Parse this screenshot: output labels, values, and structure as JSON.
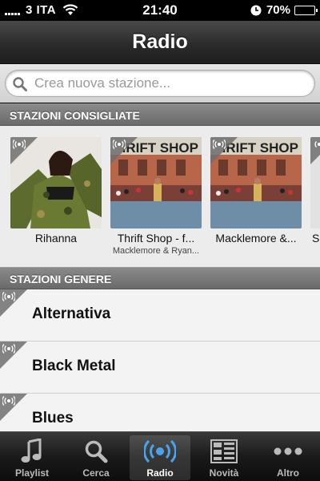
{
  "status_bar": {
    "carrier": "3 ITA",
    "time": "21:40",
    "battery": "70%",
    "battery_level": 0.7
  },
  "nav": {
    "title": "Radio"
  },
  "search": {
    "placeholder": "Crea nuova stazione..."
  },
  "sections": {
    "recommended": "STAZIONI CONSIGLIATE",
    "genres": "STAZIONI GENERE"
  },
  "recommended": [
    {
      "title": "Rihanna",
      "subtitle": ""
    },
    {
      "title": "Thrift Shop - f...",
      "subtitle": "Macklemore & Ryan...",
      "art_text": "IRIFT SHOP"
    },
    {
      "title": "Macklemore &...",
      "subtitle": "",
      "art_text": "IRIFT SHOP"
    },
    {
      "title": "Sc",
      "subtitle": ""
    }
  ],
  "genres": [
    {
      "label": "Alternativa"
    },
    {
      "label": "Black Metal"
    },
    {
      "label": "Blues"
    }
  ],
  "tabs": [
    {
      "label": "Playlist",
      "icon": "music-note-icon"
    },
    {
      "label": "Cerca",
      "icon": "search-icon"
    },
    {
      "label": "Radio",
      "icon": "radio-icon",
      "active": true
    },
    {
      "label": "Novità",
      "icon": "news-icon"
    },
    {
      "label": "Altro",
      "icon": "more-icon"
    }
  ],
  "colors": {
    "header": "#2b2b2b",
    "section": "#7a7a7a",
    "accent": "#3a8fd6"
  }
}
